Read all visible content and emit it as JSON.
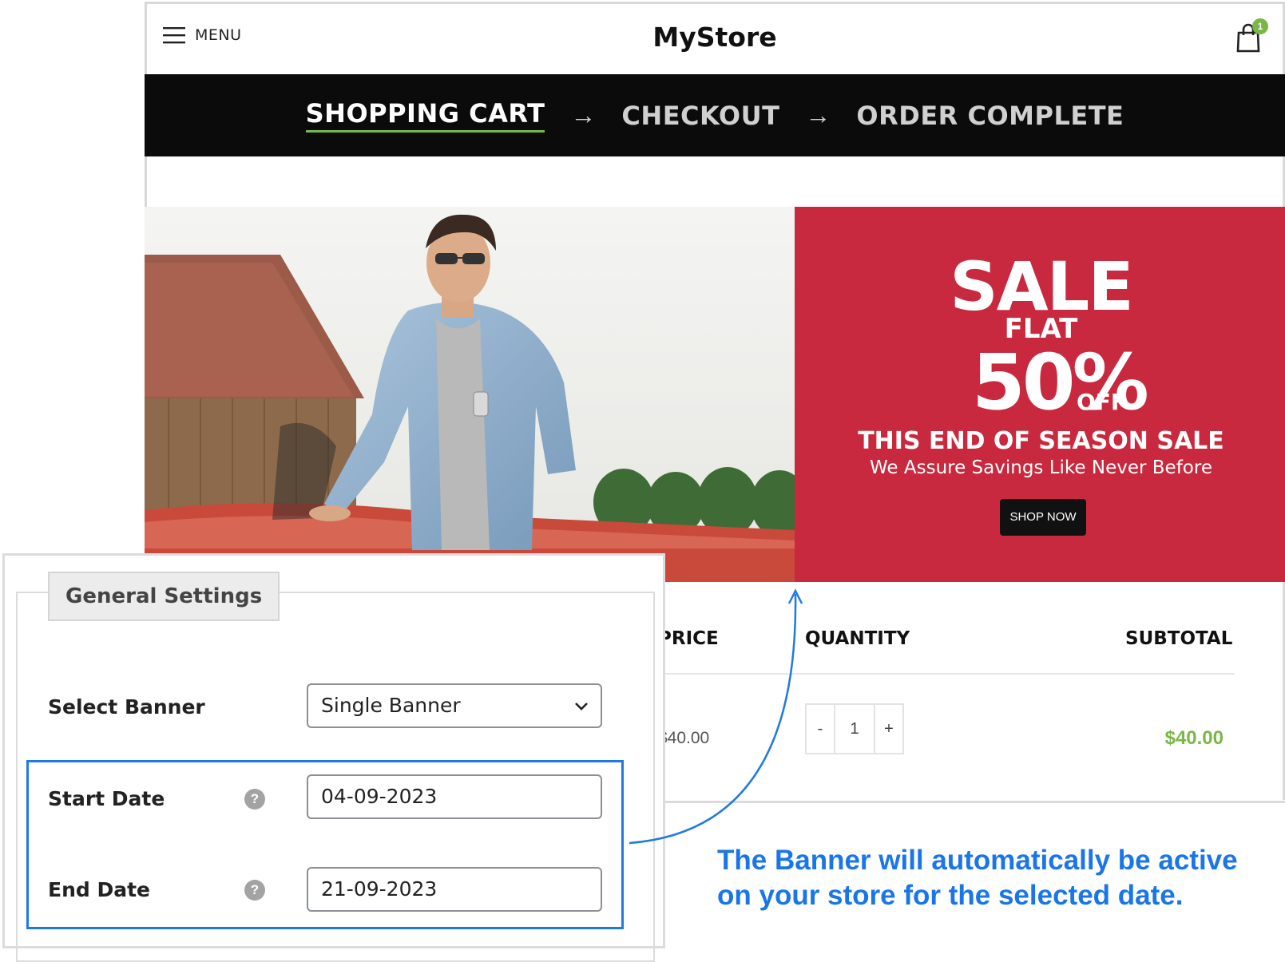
{
  "header": {
    "menu_label": "MENU",
    "store_name": "MyStore",
    "cart_count": "1"
  },
  "steps": {
    "items": [
      "SHOPPING CART",
      "CHECKOUT",
      "ORDER COMPLETE"
    ],
    "arrow": "→",
    "active": "SHOPPING CART"
  },
  "banner": {
    "sale": "SALE",
    "flat": "FLAT",
    "percent": "50%",
    "off": "OFF",
    "headline": "THIS END OF SEASON SALE",
    "subline": "We Assure Savings Like Never Before",
    "button": "SHOP NOW",
    "color": "#c9293e"
  },
  "cart": {
    "headers": {
      "price": "PRICE",
      "quantity": "QUANTITY",
      "subtotal": "SUBTOTAL"
    },
    "row": {
      "price": "$40.00",
      "minus": "-",
      "qty": "1",
      "plus": "+",
      "subtotal": "$40.00"
    },
    "accent": "#7ab648"
  },
  "settings": {
    "legend": "General Settings",
    "select_banner_label": "Select Banner",
    "select_banner_value": "Single Banner",
    "start_date_label": "Start Date",
    "start_date_value": "04-09-2023",
    "end_date_label": "End Date",
    "end_date_value": "21-09-2023",
    "help_glyph": "?"
  },
  "annotation": {
    "line1": "The Banner will automatically be active",
    "line2": "on your store for the selected date.",
    "color": "#1a76e8"
  }
}
